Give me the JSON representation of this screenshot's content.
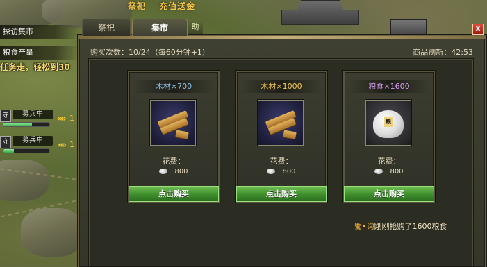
{
  "top_links": [
    "祭祀",
    "充值送金"
  ],
  "sidebar": {
    "visit_market": "探访集市",
    "food_output": "粮食产量",
    "quest_text": "任务走，轻松到30"
  },
  "hud_units": [
    {
      "label": "募兵中",
      "flag": "守",
      "progress": 0.62,
      "arrows": "»»",
      "num": "1"
    },
    {
      "label": "募兵中",
      "flag": "守",
      "progress": 0.22,
      "arrows": "»»",
      "num": "1"
    }
  ],
  "tabs": {
    "sacrifice": "祭祀",
    "market": "集市",
    "ghost": "助"
  },
  "close_label": "X",
  "purchase_info": "购买次数：10/24（每60分钟+1）",
  "refresh_info": "商品刷新：42:53",
  "items": [
    {
      "title": "木材×700",
      "cost_label": "花费：",
      "cost": "800",
      "buy_label": "点击购买"
    },
    {
      "title": "木材×1000",
      "cost_label": "花费：",
      "cost": "800",
      "buy_label": "点击购买"
    },
    {
      "title": "粮食×1600",
      "cost_label": "花费：",
      "cost": "800",
      "buy_label": "点击购买",
      "icon_tag": "粮"
    }
  ],
  "log": {
    "player": "蜀•询",
    "message": "刚刚抢购了1600粮食"
  }
}
